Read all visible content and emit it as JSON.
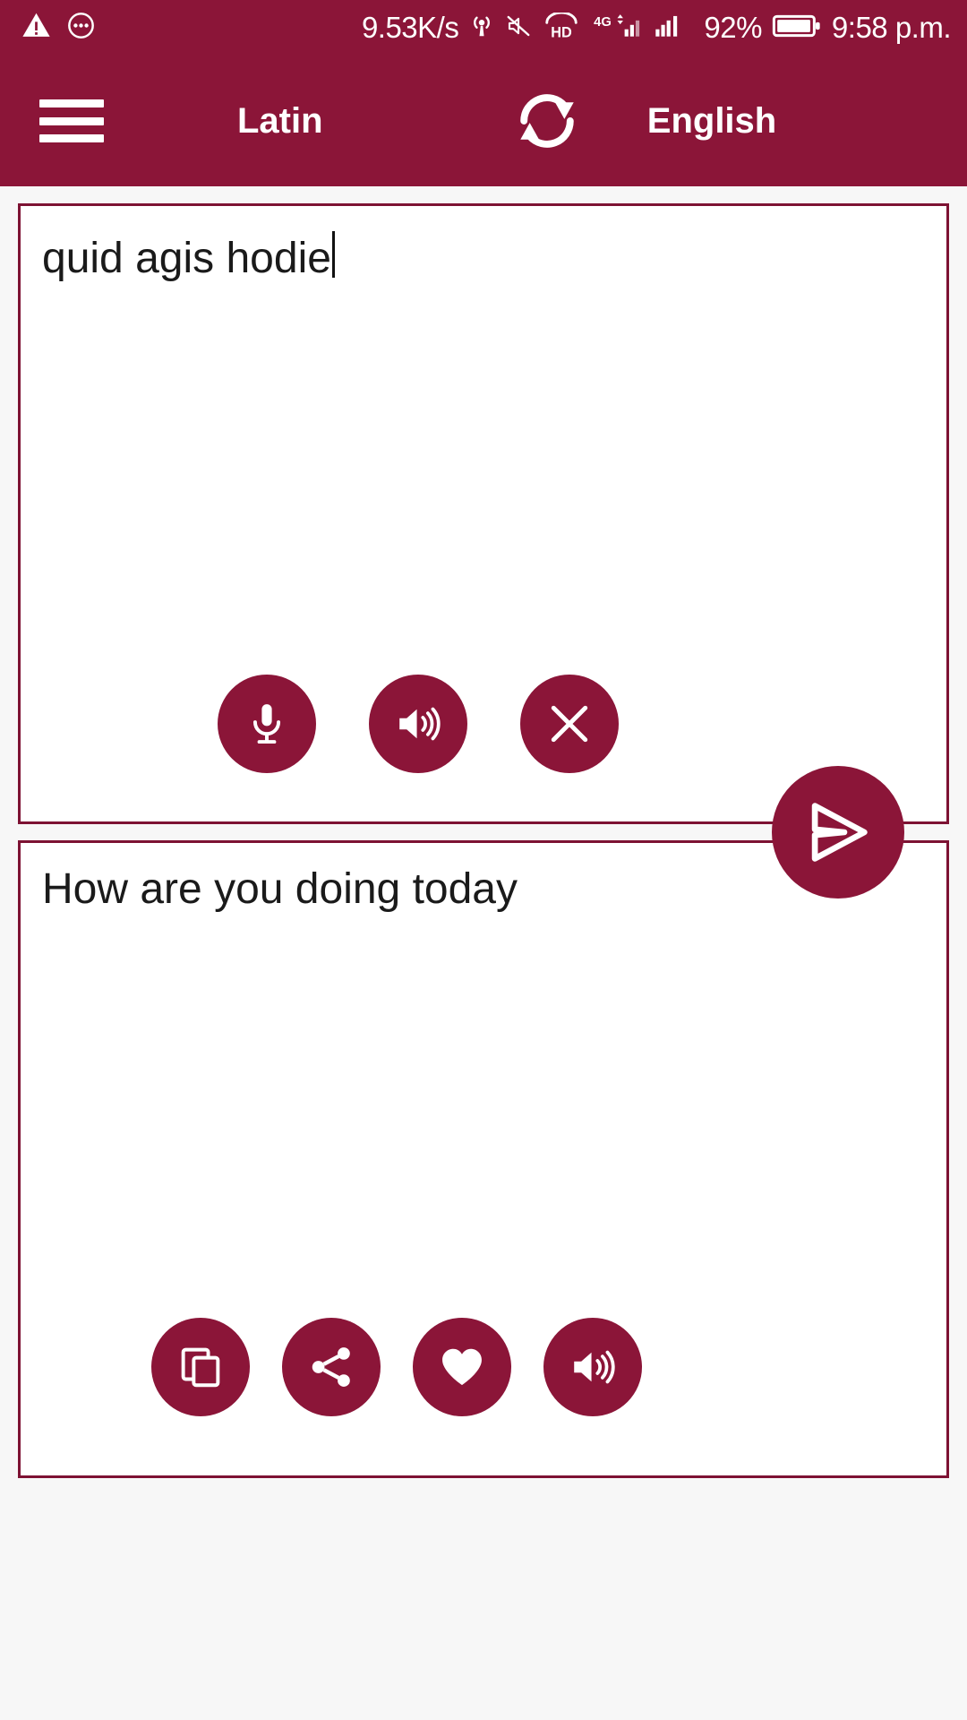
{
  "theme": {
    "brand_color": "#8b1538",
    "border_color": "#7d1233",
    "page_background": "#f7f7f7",
    "card_background": "#ffffff",
    "text_color": "#1a1a1a",
    "on_brand_color": "#ffffff"
  },
  "status_bar": {
    "left_icons": [
      {
        "name": "warning-triangle-icon",
        "glyph": "warning"
      },
      {
        "name": "ellipsis-circle-icon",
        "glyph": "ellipsis"
      }
    ],
    "network_speed": "9.53K/s",
    "right_icons": [
      {
        "name": "hotspot-icon",
        "glyph": "hotspot"
      },
      {
        "name": "mute-icon",
        "glyph": "mute"
      },
      {
        "name": "hd-icon",
        "glyph": "hd"
      },
      {
        "name": "signal-4g-icon",
        "glyph": "4g-signal"
      },
      {
        "name": "signal-bars-icon",
        "glyph": "signal-bars"
      }
    ],
    "battery_percent": "92%",
    "battery_icon": "battery-icon",
    "time": "9:58 p.m."
  },
  "header": {
    "menu_icon": "hamburger-menu-icon",
    "source_language": "Latin",
    "target_language": "English",
    "swap_icon": "swap-languages-icon"
  },
  "input_card": {
    "text": "quid agis hodie",
    "has_caret": true,
    "buttons": [
      {
        "name": "microphone-button",
        "icon": "microphone-icon",
        "label": "Voice input"
      },
      {
        "name": "speak-source-button",
        "icon": "speaker-icon",
        "label": "Speak source text"
      },
      {
        "name": "clear-button",
        "icon": "close-icon",
        "label": "Clear text"
      }
    ]
  },
  "send_button": {
    "name": "send-translate-button",
    "icon": "send-icon",
    "label": "Translate"
  },
  "output_card": {
    "text": "How are you doing today",
    "buttons": [
      {
        "name": "copy-button",
        "icon": "copy-icon",
        "label": "Copy translation"
      },
      {
        "name": "share-button",
        "icon": "share-icon",
        "label": "Share translation"
      },
      {
        "name": "favorite-button",
        "icon": "heart-icon",
        "label": "Add to favorites"
      },
      {
        "name": "speak-target-button",
        "icon": "speaker-icon",
        "label": "Speak translation"
      }
    ]
  }
}
